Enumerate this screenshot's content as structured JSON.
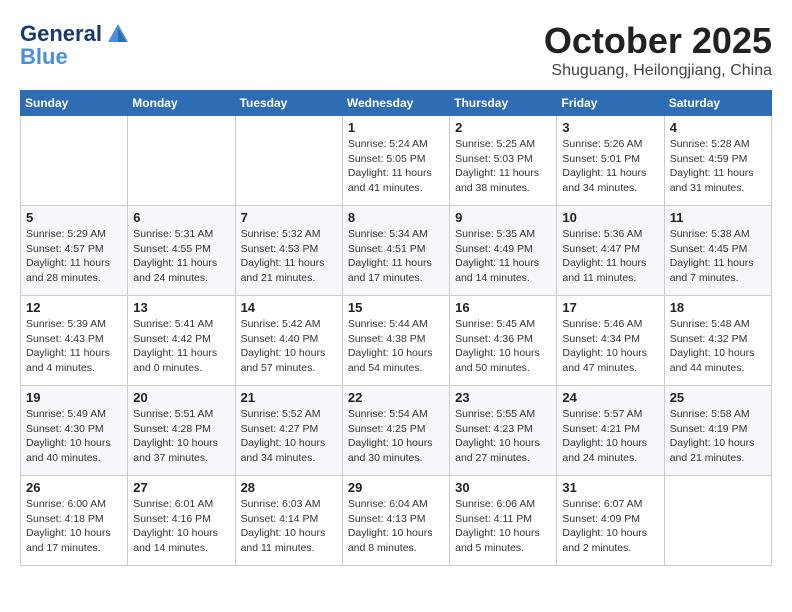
{
  "header": {
    "logo_line1": "General",
    "logo_line2": "Blue",
    "month_title": "October 2025",
    "location": "Shuguang, Heilongjiang, China"
  },
  "weekdays": [
    "Sunday",
    "Monday",
    "Tuesday",
    "Wednesday",
    "Thursday",
    "Friday",
    "Saturday"
  ],
  "weeks": [
    [
      {
        "day": "",
        "info": ""
      },
      {
        "day": "",
        "info": ""
      },
      {
        "day": "",
        "info": ""
      },
      {
        "day": "1",
        "info": "Sunrise: 5:24 AM\nSunset: 5:05 PM\nDaylight: 11 hours and 41 minutes."
      },
      {
        "day": "2",
        "info": "Sunrise: 5:25 AM\nSunset: 5:03 PM\nDaylight: 11 hours and 38 minutes."
      },
      {
        "day": "3",
        "info": "Sunrise: 5:26 AM\nSunset: 5:01 PM\nDaylight: 11 hours and 34 minutes."
      },
      {
        "day": "4",
        "info": "Sunrise: 5:28 AM\nSunset: 4:59 PM\nDaylight: 11 hours and 31 minutes."
      }
    ],
    [
      {
        "day": "5",
        "info": "Sunrise: 5:29 AM\nSunset: 4:57 PM\nDaylight: 11 hours and 28 minutes."
      },
      {
        "day": "6",
        "info": "Sunrise: 5:31 AM\nSunset: 4:55 PM\nDaylight: 11 hours and 24 minutes."
      },
      {
        "day": "7",
        "info": "Sunrise: 5:32 AM\nSunset: 4:53 PM\nDaylight: 11 hours and 21 minutes."
      },
      {
        "day": "8",
        "info": "Sunrise: 5:34 AM\nSunset: 4:51 PM\nDaylight: 11 hours and 17 minutes."
      },
      {
        "day": "9",
        "info": "Sunrise: 5:35 AM\nSunset: 4:49 PM\nDaylight: 11 hours and 14 minutes."
      },
      {
        "day": "10",
        "info": "Sunrise: 5:36 AM\nSunset: 4:47 PM\nDaylight: 11 hours and 11 minutes."
      },
      {
        "day": "11",
        "info": "Sunrise: 5:38 AM\nSunset: 4:45 PM\nDaylight: 11 hours and 7 minutes."
      }
    ],
    [
      {
        "day": "12",
        "info": "Sunrise: 5:39 AM\nSunset: 4:43 PM\nDaylight: 11 hours and 4 minutes."
      },
      {
        "day": "13",
        "info": "Sunrise: 5:41 AM\nSunset: 4:42 PM\nDaylight: 11 hours and 0 minutes."
      },
      {
        "day": "14",
        "info": "Sunrise: 5:42 AM\nSunset: 4:40 PM\nDaylight: 10 hours and 57 minutes."
      },
      {
        "day": "15",
        "info": "Sunrise: 5:44 AM\nSunset: 4:38 PM\nDaylight: 10 hours and 54 minutes."
      },
      {
        "day": "16",
        "info": "Sunrise: 5:45 AM\nSunset: 4:36 PM\nDaylight: 10 hours and 50 minutes."
      },
      {
        "day": "17",
        "info": "Sunrise: 5:46 AM\nSunset: 4:34 PM\nDaylight: 10 hours and 47 minutes."
      },
      {
        "day": "18",
        "info": "Sunrise: 5:48 AM\nSunset: 4:32 PM\nDaylight: 10 hours and 44 minutes."
      }
    ],
    [
      {
        "day": "19",
        "info": "Sunrise: 5:49 AM\nSunset: 4:30 PM\nDaylight: 10 hours and 40 minutes."
      },
      {
        "day": "20",
        "info": "Sunrise: 5:51 AM\nSunset: 4:28 PM\nDaylight: 10 hours and 37 minutes."
      },
      {
        "day": "21",
        "info": "Sunrise: 5:52 AM\nSunset: 4:27 PM\nDaylight: 10 hours and 34 minutes."
      },
      {
        "day": "22",
        "info": "Sunrise: 5:54 AM\nSunset: 4:25 PM\nDaylight: 10 hours and 30 minutes."
      },
      {
        "day": "23",
        "info": "Sunrise: 5:55 AM\nSunset: 4:23 PM\nDaylight: 10 hours and 27 minutes."
      },
      {
        "day": "24",
        "info": "Sunrise: 5:57 AM\nSunset: 4:21 PM\nDaylight: 10 hours and 24 minutes."
      },
      {
        "day": "25",
        "info": "Sunrise: 5:58 AM\nSunset: 4:19 PM\nDaylight: 10 hours and 21 minutes."
      }
    ],
    [
      {
        "day": "26",
        "info": "Sunrise: 6:00 AM\nSunset: 4:18 PM\nDaylight: 10 hours and 17 minutes."
      },
      {
        "day": "27",
        "info": "Sunrise: 6:01 AM\nSunset: 4:16 PM\nDaylight: 10 hours and 14 minutes."
      },
      {
        "day": "28",
        "info": "Sunrise: 6:03 AM\nSunset: 4:14 PM\nDaylight: 10 hours and 11 minutes."
      },
      {
        "day": "29",
        "info": "Sunrise: 6:04 AM\nSunset: 4:13 PM\nDaylight: 10 hours and 8 minutes."
      },
      {
        "day": "30",
        "info": "Sunrise: 6:06 AM\nSunset: 4:11 PM\nDaylight: 10 hours and 5 minutes."
      },
      {
        "day": "31",
        "info": "Sunrise: 6:07 AM\nSunset: 4:09 PM\nDaylight: 10 hours and 2 minutes."
      },
      {
        "day": "",
        "info": ""
      }
    ]
  ]
}
